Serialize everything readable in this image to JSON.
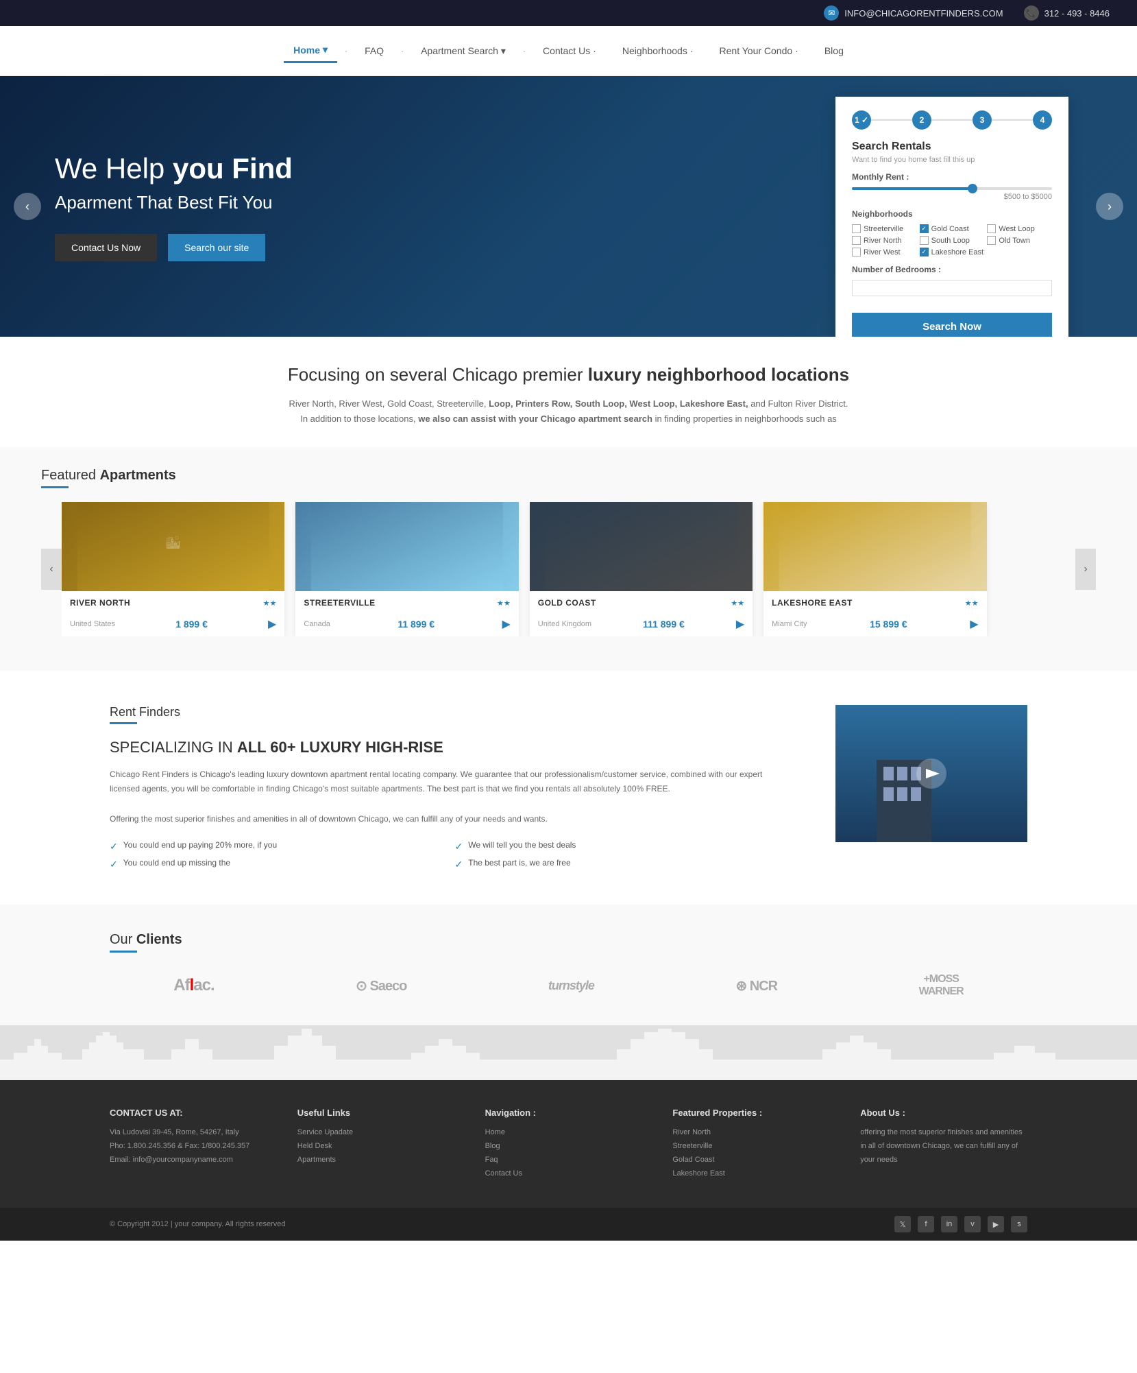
{
  "topbar": {
    "email": "INFO@CHICAGORENTFINDERS.COM",
    "phone": "312 - 493 - 8446"
  },
  "nav": {
    "items": [
      {
        "label": "Home",
        "active": true
      },
      {
        "label": "FAQ"
      },
      {
        "label": "Apartment Search"
      },
      {
        "label": "Contact Us"
      },
      {
        "label": "Neighborhoods"
      },
      {
        "label": "Rent Your Condo"
      },
      {
        "label": "Blog"
      }
    ]
  },
  "hero": {
    "title_part1": "We Help ",
    "title_bold": "you Find",
    "subtitle": "Aparment That Best Fit You",
    "btn_contact": "Contact Us Now",
    "btn_search": "Search our site"
  },
  "search_panel": {
    "title": "Search Rentals",
    "subtitle": "Want to find you home fast fill this up",
    "steps": [
      "1",
      "2",
      "3",
      "4"
    ],
    "rent_label": "Monthly Rent :",
    "rent_range": "$500 to $5000",
    "neighborhoods_label": "Neighborhoods",
    "neighborhoods": [
      {
        "label": "Streeterville",
        "checked": false
      },
      {
        "label": "Gold Coast",
        "checked": true
      },
      {
        "label": "West Loop",
        "checked": false
      },
      {
        "label": "River North",
        "checked": false
      },
      {
        "label": "South Loop",
        "checked": false
      },
      {
        "label": "Old Town",
        "checked": false
      },
      {
        "label": "River West",
        "checked": false
      },
      {
        "label": "Lakeshore East",
        "checked": true
      }
    ],
    "bedrooms_label": "Number of Bedrooms :",
    "search_btn": "Search Now"
  },
  "focus": {
    "heading_plain": "Focusing on several Chicago premier ",
    "heading_bold": "luxury neighborhood locations",
    "text_normal": "River North, River West, Gold Coast, Streeterville, ",
    "text_bold1": "Loop, Printers Row, South Loop, West Loop, Lakeshore East,",
    "text_and": " and Fulton River District.",
    "text2_plain": "In addition to those locations, ",
    "text2_bold": "we also can assist with your Chicago apartment search",
    "text2_end": " in finding properties in neighborhoods such as"
  },
  "featured": {
    "title_plain": "Featured ",
    "title_bold": "Apartments",
    "apartments": [
      {
        "name": "RIVER NORTH",
        "stars": "★★",
        "country": "United States",
        "price": "1 899 €"
      },
      {
        "name": "STREETERVILLE",
        "stars": "★★",
        "country": "Canada",
        "price": "11 899 €"
      },
      {
        "name": "GOLD COAST",
        "stars": "★★",
        "country": "United Kingdom",
        "price": "111 899 €"
      },
      {
        "name": "LAKESHORE EAST",
        "stars": "★★",
        "country": "Miami City",
        "price": "15 899 €"
      }
    ]
  },
  "rent_finders": {
    "section_label": "Rent Finders",
    "heading_plain": "SPECIALIZING IN ",
    "heading_bold": "ALL 60+ LUXURY HIGH-RISE",
    "text": "Chicago Rent Finders is Chicago's leading luxury downtown apartment rental locating company. We guarantee that our professionalism/customer service, combined with our expert licensed agents, you will be comfortable in finding Chicago's most suitable apartments. The best part is that we find you rentals all absolutely 100% FREE.\nOffering the most superior finishes and amenities in all of downtown Chicago, we can fulfill any of your needs and wants.",
    "checks": [
      "You could end up paying 20% more, if you",
      "We will tell you the best deals",
      "You could end up missing the",
      "The best part is, we are free"
    ]
  },
  "clients": {
    "title_plain": "Our ",
    "title_bold": "Clients",
    "logos": [
      "Aflac.",
      "Saeco",
      "turnstyle",
      "NCR",
      "+MOSS\nWARNER"
    ]
  },
  "footer": {
    "contact": {
      "title": "CONTACT US AT:",
      "address": "Via Ludovisi 39-45, Rome, 54267, Italy",
      "phone": "Pho: 1.800.245.356 & Fax: 1/800.245.357",
      "email": "Email: info@yourcompanyname.com"
    },
    "useful_links": {
      "title": "Useful Links",
      "items": [
        "Service Upadate",
        "Held Desk",
        "Apartments"
      ]
    },
    "navigation": {
      "title": "Navigation :",
      "items": [
        "Home",
        "Blog",
        "Faq",
        "Contact Us"
      ]
    },
    "featured_props": {
      "title": "Featured Properties :",
      "items": [
        "River North",
        "Streeterville",
        "Golad Coast",
        "Lakeshore East"
      ]
    },
    "about": {
      "title": "About Us :",
      "text": "offering the most superior finishes and amenities in all of downtown Chicago, we can fulfill any of your needs"
    },
    "copyright": "© Copyright 2012 | your company. All rights reserved",
    "social_icons": [
      "𝕏",
      "f",
      "🔗",
      "v",
      "▶",
      "s"
    ]
  }
}
